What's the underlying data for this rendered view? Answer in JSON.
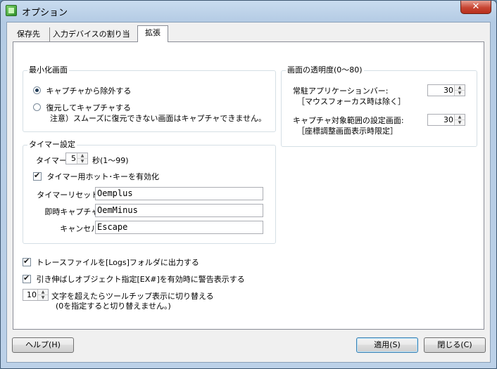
{
  "window": {
    "title": "オプション",
    "close_glyph": "✕"
  },
  "tabs": [
    {
      "label": "保存先"
    },
    {
      "label": "入力デバイスの割り当て"
    },
    {
      "label": "拡張",
      "active": true
    }
  ],
  "minimize_group": {
    "title": "最小化画面",
    "option1": "キャプチャから除外する",
    "option2": "復元してキャプチャする",
    "note": "注意）スムーズに復元できない画面はキャプチャできません。",
    "selected": "option1"
  },
  "timer_group": {
    "title": "タイマー設定",
    "timer_label": "タイマー:",
    "timer_value": "5",
    "timer_unit": "秒(1〜99)",
    "hotkey_label": "タイマー用ホット･キーを有効化",
    "hotkey_checked": true,
    "reset_label": "タイマーリセット:",
    "reset_value": "Oemplus",
    "immediate_label": "即時キャプチャ:",
    "immediate_value": "OemMinus",
    "cancel_label": "キャンセル:",
    "cancel_value": "Escape"
  },
  "transparency_group": {
    "title": "画面の透明度(0〜80)",
    "appbar_label_1": "常駐アプリケーションバー:",
    "appbar_label_2": "［マウスフォーカス時は除く］",
    "appbar_value": "30",
    "capture_label_1": "キャプチャ対象範囲の設定画面:",
    "capture_label_2": "［座標調整画面表示時限定］",
    "capture_value": "30"
  },
  "options": {
    "trace_label": "トレースファイルを[Logs]フォルダに出力する",
    "trace_checked": true,
    "stretch_label": "引き伸ばしオブジェクト指定[EX#]を有効時に警告表示する",
    "stretch_checked": true,
    "tooltip_value": "10",
    "tooltip_label_1": "文字を超えたらツールチップ表示に切り替える",
    "tooltip_label_2": "(0を指定すると切り替えません。)"
  },
  "buttons": {
    "help": "ヘルプ(H)",
    "apply": "適用(S)",
    "close": "閉じる(C)"
  },
  "spin_glyphs": {
    "up": "▲",
    "down": "▼"
  }
}
